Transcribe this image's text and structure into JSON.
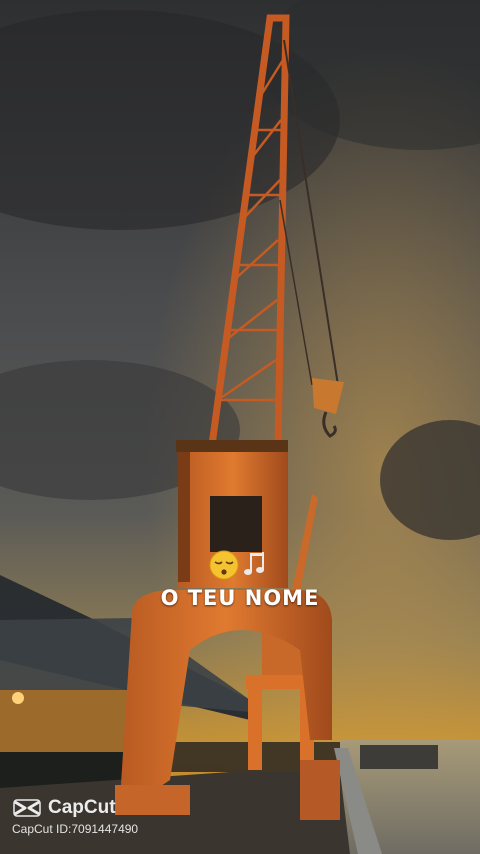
{
  "overlay": {
    "caption": "O TEU NOME",
    "emoji": "sleepy-face-with-music-notes"
  },
  "watermark": {
    "brand": "CapCut",
    "id_text": "CapCut ID:7091447490",
    "logo_icon": "capcut-logo-icon"
  },
  "colors": {
    "sky_top": "#3a3b3d",
    "sky_sunset": "#c08b2e",
    "crane": "#d9712a",
    "sea": "#8c8a7e"
  }
}
